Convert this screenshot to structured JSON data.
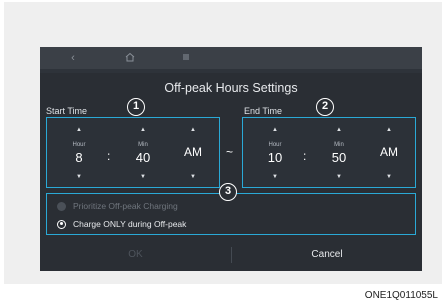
{
  "navbar": {
    "back_icon": "chevron-left-icon",
    "home_icon": "home-icon",
    "menu_icon": "menu-icon"
  },
  "dialog": {
    "title": "Off-peak Hours Settings",
    "start": {
      "label": "Start Time",
      "hour_unit": "Hour",
      "hour": "8",
      "min_unit": "Min",
      "min": "40",
      "ampm": "AM"
    },
    "end": {
      "label": "End Time",
      "hour_unit": "Hour",
      "hour": "10",
      "min_unit": "Min",
      "min": "50",
      "ampm": "AM"
    },
    "separator": "~",
    "colon": ":",
    "options": [
      {
        "label": "Prioritize Off-peak Charging",
        "selected": false
      },
      {
        "label": "Charge ONLY during Off-peak",
        "selected": true
      }
    ],
    "ok_label": "OK",
    "cancel_label": "Cancel"
  },
  "callouts": [
    "1",
    "2",
    "3"
  ],
  "caption": "ONE1Q011055L",
  "colors": {
    "accent": "#2aa9d6",
    "background": "#2a2e34"
  }
}
